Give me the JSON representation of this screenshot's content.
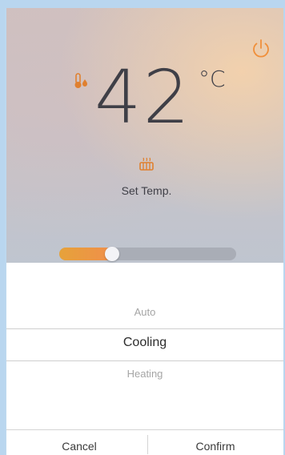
{
  "header": {
    "power_icon": "power-icon",
    "thermometer_icon": "thermometer-icon"
  },
  "temperature": {
    "value": "42",
    "unit": "°C"
  },
  "mode": {
    "icon": "heater-icon",
    "label": "Set Temp."
  },
  "slider": {
    "level_percent": 30
  },
  "picker": {
    "options": [
      "Auto",
      "Cooling",
      "Heating"
    ],
    "selected": "Cooling"
  },
  "footer": {
    "cancel_label": "Cancel",
    "confirm_label": "Confirm"
  },
  "colors": {
    "accent": "#f08f3a",
    "text_dark": "#3f3f47"
  }
}
